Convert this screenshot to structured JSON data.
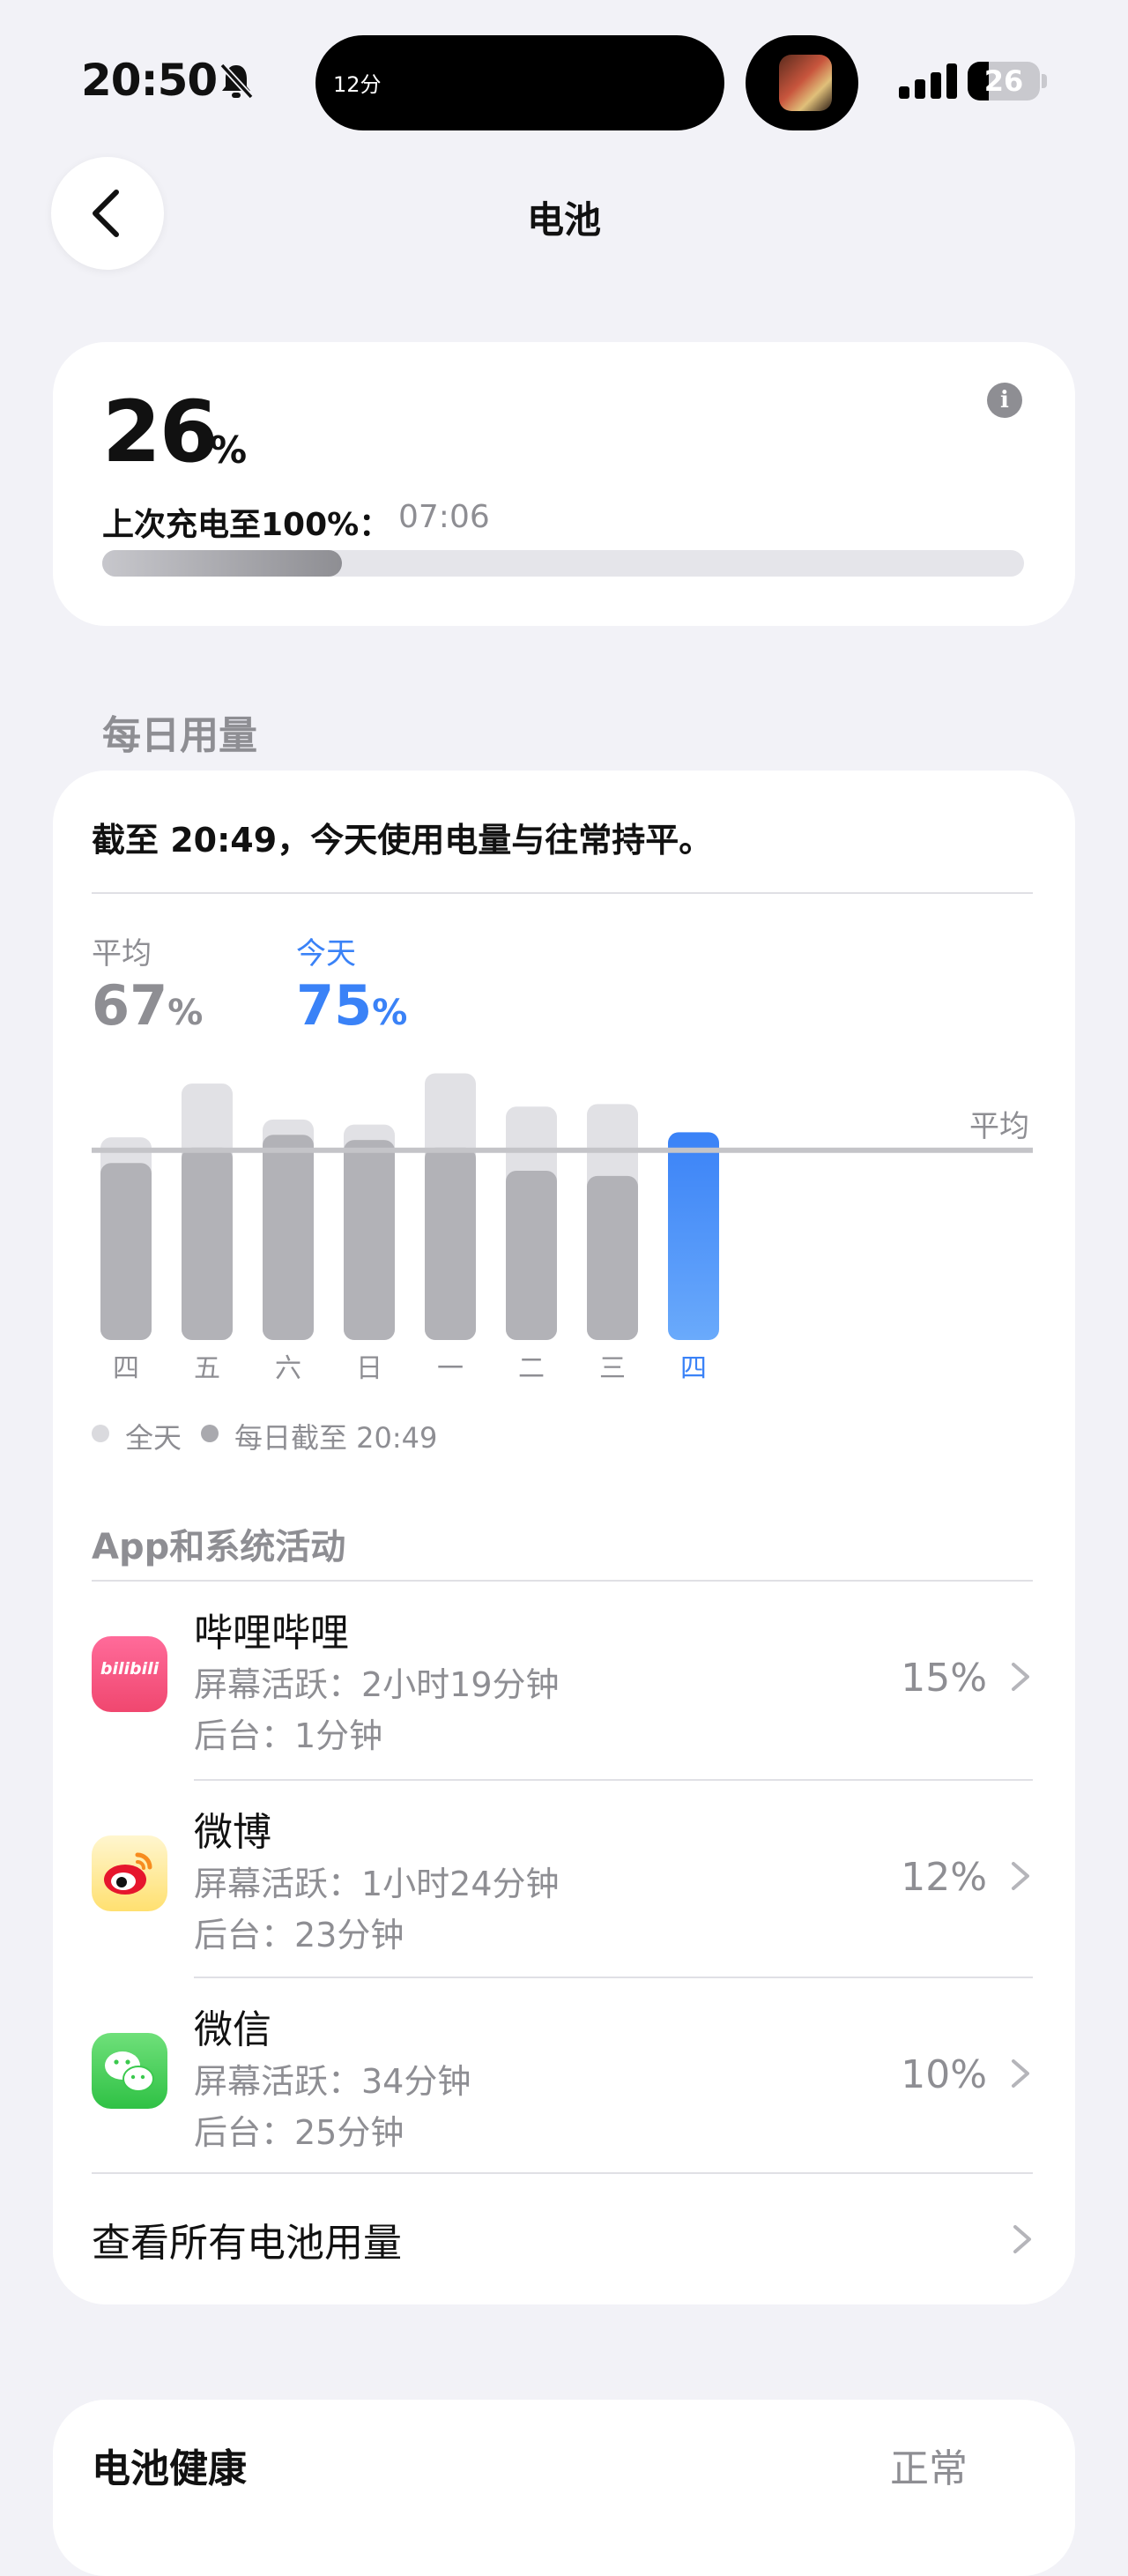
{
  "status_bar": {
    "time": "20:50",
    "island_text": "12分",
    "battery": "26"
  },
  "header": {
    "title": "电池"
  },
  "battery_card": {
    "level_number": "26",
    "level_unit": "%",
    "level_fraction": 0.26,
    "last_charge_label": "上次充电至100%：",
    "last_charge_time": "07:06",
    "info_icon": "i"
  },
  "daily_usage": {
    "section_title": "每日用量",
    "summary": "截至 20:49，今天使用电量与往常持平。",
    "avg_label": "平均",
    "avg_value": "67",
    "avg_unit": "%",
    "today_label": "今天",
    "today_value": "75",
    "today_unit": "%",
    "avg_line_label": "平均",
    "legend": [
      {
        "label": "全天",
        "color": "#dadade"
      },
      {
        "label": "每日截至 20:49",
        "color": "#a9a9ae"
      }
    ]
  },
  "chart_data": {
    "type": "bar",
    "categories": [
      "四",
      "五",
      "六",
      "日",
      "一",
      "二",
      "三",
      "四"
    ],
    "series": [
      {
        "name": "全天",
        "values": [
          79,
          100,
          86,
          84,
          104,
          91,
          92,
          null
        ],
        "color": "#e1e1e5"
      },
      {
        "name": "每日截至 20:49",
        "values": [
          69,
          75,
          80,
          78,
          75,
          66,
          64,
          81
        ],
        "color": "#b2b2b7"
      }
    ],
    "today_color": "#3a82f7",
    "average_line": 74,
    "ylim": [
      0,
      110
    ]
  },
  "apps": {
    "section_title": "App和系统活动",
    "items": [
      {
        "name": "哔哩哔哩",
        "screen": "屏幕活跃：2小时19分钟",
        "background": "后台：1分钟",
        "pct": "15%",
        "icon": "bilibili-icon",
        "icon_text": "bilibili"
      },
      {
        "name": "微博",
        "screen": "屏幕活跃：1小时24分钟",
        "background": "后台：23分钟",
        "pct": "12%",
        "icon": "weibo-icon"
      },
      {
        "name": "微信",
        "screen": "屏幕活跃：34分钟",
        "background": "后台：25分钟",
        "pct": "10%",
        "icon": "wechat-icon"
      }
    ],
    "see_all": "查看所有电池用量"
  },
  "bottom_card": {
    "left_text": "电池健康",
    "right_text": "正常"
  }
}
